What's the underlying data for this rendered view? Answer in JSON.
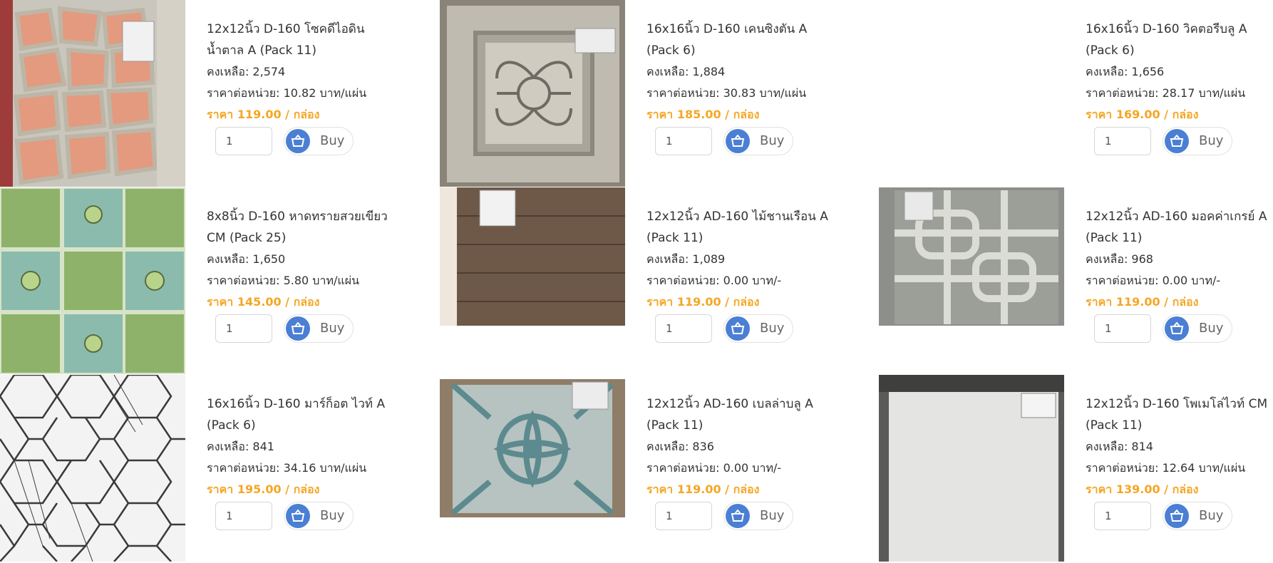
{
  "buy_label": "Buy",
  "colors": {
    "price": "#f5a623",
    "buy_icon": "#4a7fd4"
  },
  "products": [
    {
      "title": "12x12นิ้ว D-160 โซคดีไอดิน น้ำตาล A (Pack 11)",
      "stock": "คงเหลือ: 2,574",
      "unit_price": "ราคาต่อหน่วย: 10.82 บาท/แผ่น",
      "price": "ราคา 119.00 / กล่อง",
      "qty": "1",
      "image": "terracotta-flagstone"
    },
    {
      "title": "16x16นิ้ว D-160 เคนซิงตัน A (Pack 6)",
      "stock": "คงเหลือ: 1,884",
      "unit_price": "ราคาต่อหน่วย: 30.83 บาท/แผ่น",
      "price": "ราคา 185.00 / กล่อง",
      "qty": "1",
      "image": "grey-ornament"
    },
    {
      "title": "16x16นิ้ว D-160 วิคตอรีบลู A (Pack 6)",
      "stock": "คงเหลือ: 1,656",
      "unit_price": "ราคาต่อหน่วย: 28.17 บาท/แผ่น",
      "price": "ราคา 169.00 / กล่อง",
      "qty": "1",
      "image": "none"
    },
    {
      "title": "8x8นิ้ว D-160 หาดทรายสวยเขียว CM (Pack 25)",
      "stock": "คงเหลือ: 1,650",
      "unit_price": "ราคาต่อหน่วย: 5.80 บาท/แผ่น",
      "price": "ราคา 145.00 / กล่อง",
      "qty": "1",
      "image": "green-flower"
    },
    {
      "title": "12x12นิ้ว AD-160 ไม้ชานเรือน A (Pack 11)",
      "stock": "คงเหลือ: 1,089",
      "unit_price": "ราคาต่อหน่วย: 0.00 บาท/-",
      "price": "ราคา 119.00 / กล่อง",
      "qty": "1",
      "image": "wood-plank"
    },
    {
      "title": "12x12นิ้ว AD-160 มอคค่าเกรย์ A (Pack 11)",
      "stock": "คงเหลือ: 968",
      "unit_price": "ราคาต่อหน่วย: 0.00 บาท/-",
      "price": "ราคา 119.00 / กล่อง",
      "qty": "1",
      "image": "grey-granite-grid"
    },
    {
      "title": "16x16นิ้ว D-160 มาร์ก็อต ไวท์ A (Pack 6)",
      "stock": "คงเหลือ: 841",
      "unit_price": "ราคาต่อหน่วย: 34.16 บาท/แผ่น",
      "price": "ราคา 195.00 / กล่อง",
      "qty": "1",
      "image": "white-hexagon"
    },
    {
      "title": "12x12นิ้ว AD-160 เบลล่าบลู A (Pack 11)",
      "stock": "คงเหลือ: 836",
      "unit_price": "ราคาต่อหน่วย: 0.00 บาท/-",
      "price": "ราคา 119.00 / กล่อง",
      "qty": "1",
      "image": "blue-medallion"
    },
    {
      "title": "12x12นิ้ว D-160 โพเมโล่ไวท์ CM (Pack 11)",
      "stock": "คงเหลือ: 814",
      "unit_price": "ราคาต่อหน่วย: 12.64 บาท/แผ่น",
      "price": "ราคา 139.00 / กล่อง",
      "qty": "1",
      "image": "plain-white"
    }
  ]
}
